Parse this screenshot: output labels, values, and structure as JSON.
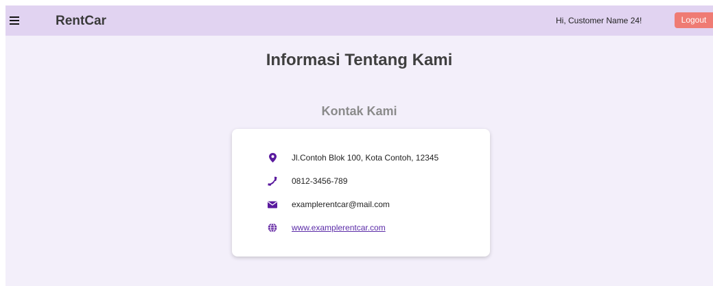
{
  "navbar": {
    "menu_icon": "hamburger-menu-icon",
    "brand": "RentCar",
    "greeting": "Hi, Customer Name 24!",
    "logout_label": "Logout"
  },
  "main": {
    "title": "Informasi Tentang Kami",
    "section_title": "Kontak Kami",
    "contacts": [
      {
        "icon": "map-pin-icon",
        "text": "Jl.Contoh Blok 100, Kota Contoh, 12345"
      },
      {
        "icon": "phone-icon",
        "text": "0812-3456-789"
      },
      {
        "icon": "envelope-icon",
        "text": "examplerentcar@mail.com"
      },
      {
        "icon": "globe-icon",
        "text": "www.examplerentcar.com"
      }
    ]
  },
  "colors": {
    "navbar_bg": "#e1d3f1",
    "page_bg": "#f3effa",
    "accent_icon": "#5a1a9e",
    "logout_bg": "#ef7b74",
    "link": "#5a2aa7"
  }
}
